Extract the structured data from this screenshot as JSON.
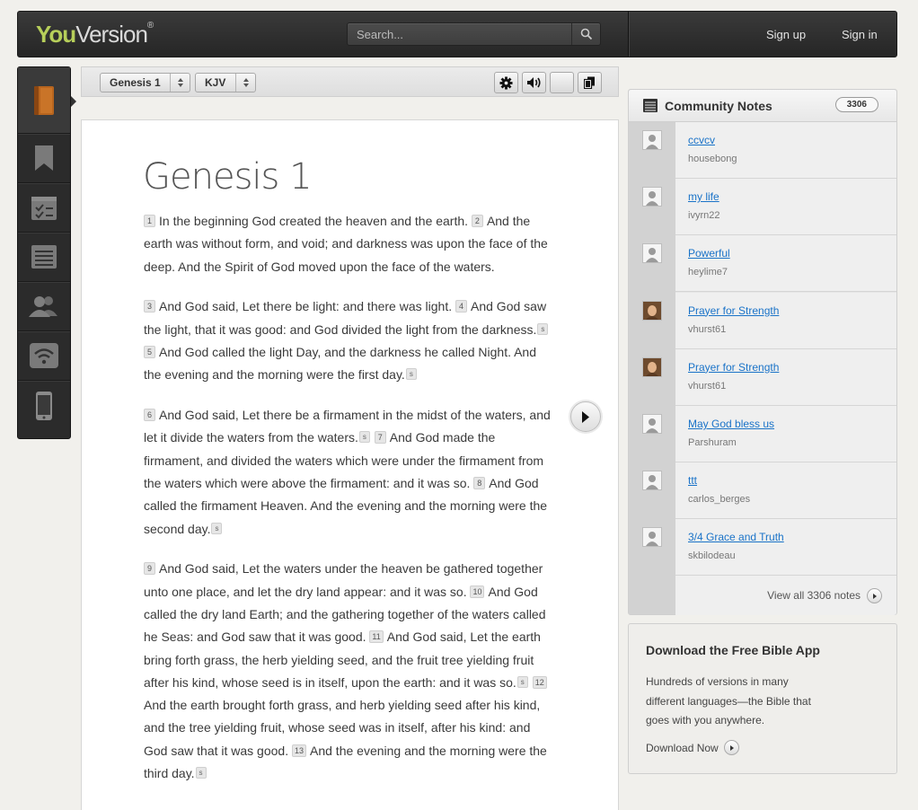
{
  "header": {
    "logo_text": "YouVersion",
    "search_placeholder": "Search...",
    "sign_up": "Sign up",
    "sign_in": "Sign in"
  },
  "rail": {
    "items": [
      "reader-icon",
      "bookmark-icon",
      "plans-icon",
      "notes-icon",
      "friends-icon",
      "live-icon",
      "mobile-icon"
    ]
  },
  "toolbar": {
    "book_chapter": "Genesis 1",
    "version": "KJV"
  },
  "reader": {
    "chapter_title": "Genesis 1",
    "paragraphs": [
      [
        {
          "v": "1",
          "text": "In the beginning God created the heaven and the earth."
        },
        {
          "v": "2",
          "text": "And the earth was without form, and void; and darkness was upon the face of the deep. And the Spirit of God moved upon the face of the waters."
        }
      ],
      [
        {
          "v": "3",
          "text": "And God said, Let there be light: and there was light."
        },
        {
          "v": "4",
          "text": "And God saw the light, that it was good: and God divided the light from the darkness.",
          "s_after": true
        },
        {
          "v": "5",
          "text": "And God called the light Day, and the darkness he called Night. And the evening and the morning were the first day.",
          "s_end": true
        }
      ],
      [
        {
          "v": "6",
          "text": "And God said, Let there be a firmament in the midst of the waters, and let it divide the waters from the waters.",
          "s_end": true
        },
        {
          "v": "7",
          "text": "And God made the firmament, and divided the waters which were under the firmament from the waters which were above the firmament: and it was so."
        },
        {
          "v": "8",
          "text": "And God called the firmament Heaven. And the evening and the morning were the second day.",
          "s_end": true
        }
      ],
      [
        {
          "v": "9",
          "text": "And God said, Let the waters under the heaven be gathered together unto one place, and let the dry land appear: and it was so."
        },
        {
          "v": "10",
          "text": "And God called the dry land Earth; and the gathering together of the waters called he Seas: and God saw that it was good."
        },
        {
          "v": "11",
          "text": "And God said, Let the earth bring forth grass, the herb yielding seed, and the fruit tree yielding fruit after his kind, whose seed is in itself, upon the earth: and it was so.",
          "s_end": true
        },
        {
          "v": "12",
          "text": "And the earth brought forth grass, and herb yielding seed after his kind, and the tree yielding fruit, whose seed was in itself, after his kind: and God saw that it was good."
        },
        {
          "v": "13",
          "text": "And the evening and the morning were the third day.",
          "s_end": true
        }
      ]
    ],
    "section_marker": "s"
  },
  "community_notes": {
    "title": "Community Notes",
    "count": "3306",
    "notes": [
      {
        "title": "ccvcv",
        "user": "housebong",
        "avatar": "default"
      },
      {
        "title": "my life",
        "user": "ivyrn22",
        "avatar": "default"
      },
      {
        "title": "Powerful",
        "user": "heylime7",
        "avatar": "default"
      },
      {
        "title": "Prayer for Strength",
        "user": "vhurst61",
        "avatar": "photo"
      },
      {
        "title": "Prayer for Strength",
        "user": "vhurst61",
        "avatar": "photo"
      },
      {
        "title": "May God bless us",
        "user": "Parshuram",
        "avatar": "default"
      },
      {
        "title": "ttt",
        "user": "carlos_berges",
        "avatar": "default"
      },
      {
        "title": "3/4 Grace and Truth",
        "user": "skbilodeau",
        "avatar": "default"
      }
    ],
    "view_all": "View all 3306 notes"
  },
  "download": {
    "heading": "Download the Free Bible App",
    "body": "Hundreds of versions in many different languages—the Bible that goes with you anywhere.",
    "link": "Download Now"
  },
  "colors": {
    "link": "#1a73c8",
    "logo_accent": "#b7cf5a",
    "dark_bar": "#2b2b2b"
  }
}
